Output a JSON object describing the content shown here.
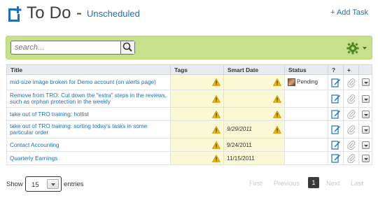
{
  "header": {
    "title": "To Do",
    "dash": "-",
    "subtitle": "Unscheduled",
    "add_task": "+ Add Task"
  },
  "search": {
    "placeholder": "search..."
  },
  "table": {
    "columns": [
      "Title",
      "Tags",
      "Smart Date",
      "Status",
      "?",
      "+"
    ],
    "rows": [
      {
        "title": "mid-size image broken for Demo account (on alerts page)",
        "date": "",
        "status": "Pending"
      },
      {
        "title": "Remove from TRO: Cut down the \"extra\" steps in the reviews, such as orphan protection in the weekly",
        "date": "",
        "status": ""
      },
      {
        "title": "take out of TRO training: hotlist",
        "date": "",
        "status": ""
      },
      {
        "title": "take out of TRO training: sorting today's tasks in some particular order",
        "date": "9/29/2011",
        "status": ""
      },
      {
        "title": "Contact Accounting",
        "date": "9/24/2011",
        "status": ""
      },
      {
        "title": "Quarterly Earnings",
        "date": "11/15/2011",
        "status": ""
      }
    ]
  },
  "footer": {
    "show_label": "Show",
    "entries_value": "15",
    "entries_label": "entries",
    "first": "First",
    "previous": "Previous",
    "current_page": "1",
    "next": "Next",
    "last": "Last"
  },
  "colors": {
    "accent": "#1f6fb6",
    "toolbar": "#c6e08c",
    "highlight_cell": "#fbf8d6",
    "warning": "#f0b400"
  },
  "icons": [
    "add-todo-icon",
    "search-icon",
    "gear-icon",
    "warning-icon",
    "edit-icon",
    "attach-icon",
    "row-menu-icon",
    "avatar"
  ]
}
